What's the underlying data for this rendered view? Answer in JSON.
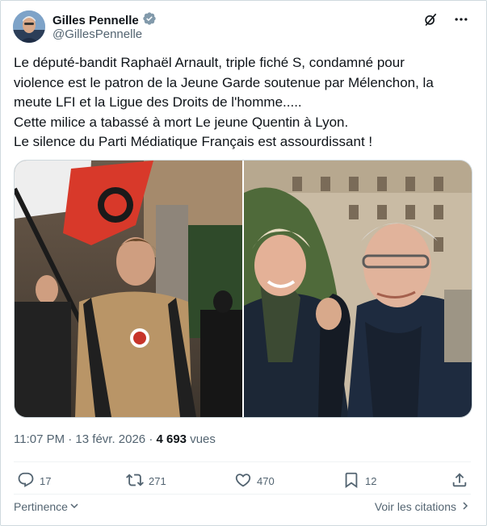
{
  "author": {
    "name": "Gilles Pennelle",
    "handle": "@GillesPennelle"
  },
  "tweet": {
    "lines": [
      "Le député-bandit Raphaël Arnault, triple fiché S, condamné pour",
      "violence est le patron de la Jeune Garde soutenue par Mélenchon, la",
      "meute LFI et la Ligue des Droits de l'homme.....",
      "Cette milice a tabassé à mort Le jeune Quentin à Lyon.",
      "Le silence du Parti Médiatique Français est assourdissant !"
    ]
  },
  "meta": {
    "timestamp": "11:07 PM · 13 févr. 2026 · ",
    "views_count": "4 693",
    "views_label": " vues"
  },
  "actions": {
    "replies": "17",
    "reposts": "271",
    "likes": "470",
    "bookmarks": "12"
  },
  "footer": {
    "relevance": "Pertinence",
    "quotes": "Voir les citations"
  },
  "colors": {
    "text": "#0f1419",
    "secondary": "#536471",
    "border": "#cfd9de",
    "verified_badge": "#829aab"
  },
  "icons": [
    "verified-badge-icon",
    "grok-icon",
    "more-icon",
    "reply-icon",
    "repost-icon",
    "like-icon",
    "bookmark-icon",
    "share-icon",
    "chevron-down-icon",
    "chevron-right-icon"
  ]
}
